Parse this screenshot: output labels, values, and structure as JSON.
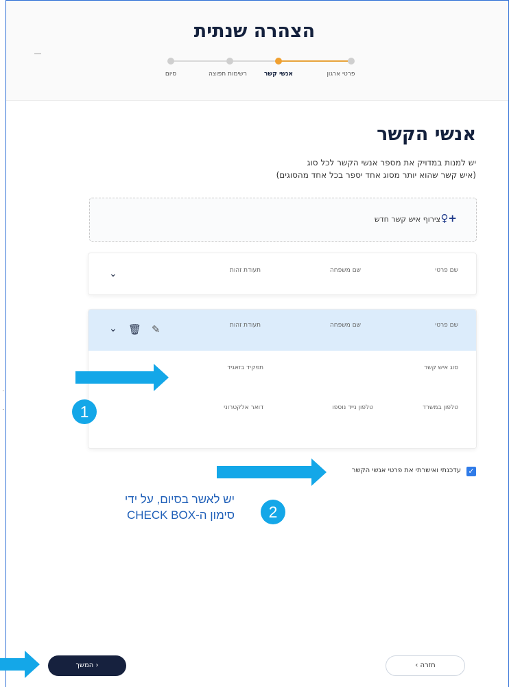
{
  "header": {
    "title": "הצהרה שנתית",
    "steps": [
      {
        "label": "פרטי ארגון",
        "state": "done"
      },
      {
        "label": "אנשי קשר",
        "state": "active"
      },
      {
        "label": "רשימות תפוצה",
        "state": "pending"
      },
      {
        "label": "סיום",
        "state": "pending"
      }
    ]
  },
  "section": {
    "title": "אנשי הקשר",
    "subtitle_line1": "יש למנות במדויק את מספר אנשי הקשר לכל סוג",
    "subtitle_line2": "(איש קשר שהוא יותר מסוג אחד יספר בכל אחד מהסוגים)"
  },
  "add_contact": {
    "label": "צירוף איש קשר חדש",
    "icon": "add-person-icon"
  },
  "contact_card_1": {
    "first_name_label": "שם פרטי",
    "last_name_label": "שם משפחה",
    "id_label": "תעודת זהות"
  },
  "contact_card_2": {
    "first_name_label": "שם פרטי",
    "last_name_label": "שם משפחה",
    "id_label": "תעודת זהות",
    "contact_type_label": "סוג איש קשר",
    "role_label": "תפקיד בזאגיד",
    "office_phone_label": "טלפון במשרד",
    "mobile_label": "טלפון נייד נוספו",
    "email_label": "דואר אלקטרוני"
  },
  "confirm": {
    "label": "עדכנתי ואישרתי את פרטי אנשי הקשר",
    "checked": true
  },
  "annotations": {
    "badge_1": "1",
    "badge_2": "2",
    "instruction_line1": "יש לאשר בסיום, על ידי",
    "instruction_line2": "סימון ה-CHECK BOX",
    "arrow_color": "#14a7e8"
  },
  "footer": {
    "next_label": "המשך",
    "back_label": "חזרה"
  },
  "colors": {
    "accent": "#f0a030",
    "primary_dark": "#16213e",
    "highlight": "#dcecfb",
    "checkbox": "#2f7be8"
  }
}
